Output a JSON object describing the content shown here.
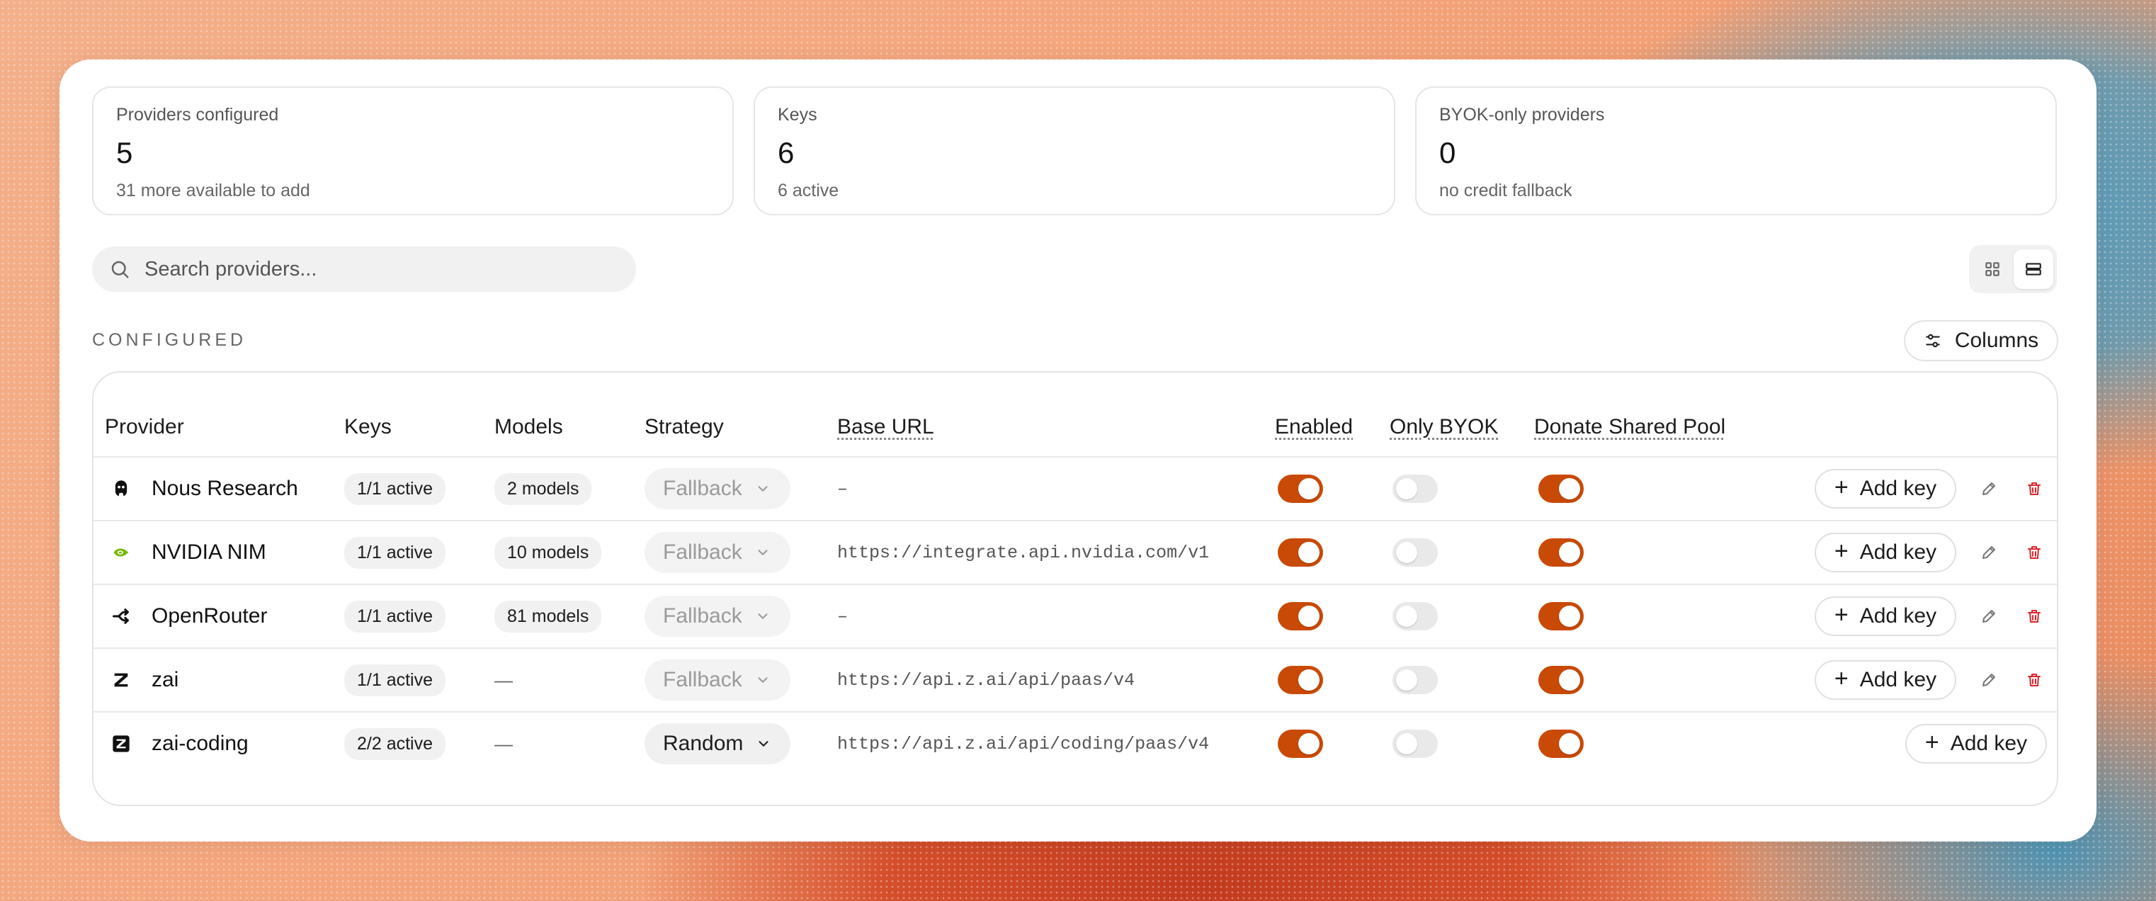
{
  "stats": [
    {
      "label": "Providers configured",
      "value": "5",
      "sub": "31 more available to add"
    },
    {
      "label": "Keys",
      "value": "6",
      "sub": "6 active"
    },
    {
      "label": "BYOK-only providers",
      "value": "0",
      "sub": "no credit fallback"
    }
  ],
  "search": {
    "placeholder": "Search providers..."
  },
  "section": {
    "title": "CONFIGURED",
    "columns_label": "Columns"
  },
  "table": {
    "headers": {
      "provider": "Provider",
      "keys": "Keys",
      "models": "Models",
      "strategy": "Strategy",
      "base_url": "Base URL",
      "enabled": "Enabled",
      "only_byok": "Only BYOK",
      "donate": "Donate Shared Pool"
    },
    "rows": [
      {
        "icon": "nous-research-icon",
        "name": "Nous Research",
        "keys": "1/1 active",
        "models": "2 models",
        "strategy": "Fallback",
        "strategy_enabled": false,
        "base_url": "–",
        "enabled": true,
        "only_byok": false,
        "donate": true,
        "add_key": "Add key",
        "editable": true
      },
      {
        "icon": "nvidia-icon",
        "name": "NVIDIA NIM",
        "keys": "1/1 active",
        "models": "10 models",
        "strategy": "Fallback",
        "strategy_enabled": false,
        "base_url": "https://integrate.api.nvidia.com/v1",
        "enabled": true,
        "only_byok": false,
        "donate": true,
        "add_key": "Add key",
        "editable": true
      },
      {
        "icon": "openrouter-icon",
        "name": "OpenRouter",
        "keys": "1/1 active",
        "models": "81 models",
        "strategy": "Fallback",
        "strategy_enabled": false,
        "base_url": "–",
        "enabled": true,
        "only_byok": false,
        "donate": true,
        "add_key": "Add key",
        "editable": true
      },
      {
        "icon": "zai-icon",
        "name": "zai",
        "keys": "1/1 active",
        "models": "—",
        "strategy": "Fallback",
        "strategy_enabled": false,
        "base_url": "https://api.z.ai/api/paas/v4",
        "enabled": true,
        "only_byok": false,
        "donate": true,
        "add_key": "Add key",
        "editable": true
      },
      {
        "icon": "zai-coding-icon",
        "name": "zai-coding",
        "keys": "2/2 active",
        "models": "—",
        "strategy": "Random",
        "strategy_enabled": true,
        "base_url": "https://api.z.ai/api/coding/paas/v4",
        "enabled": true,
        "only_byok": false,
        "donate": true,
        "add_key": "Add key",
        "editable": false
      }
    ]
  },
  "colors": {
    "accent": "#c94a06",
    "danger": "#e0242a"
  }
}
